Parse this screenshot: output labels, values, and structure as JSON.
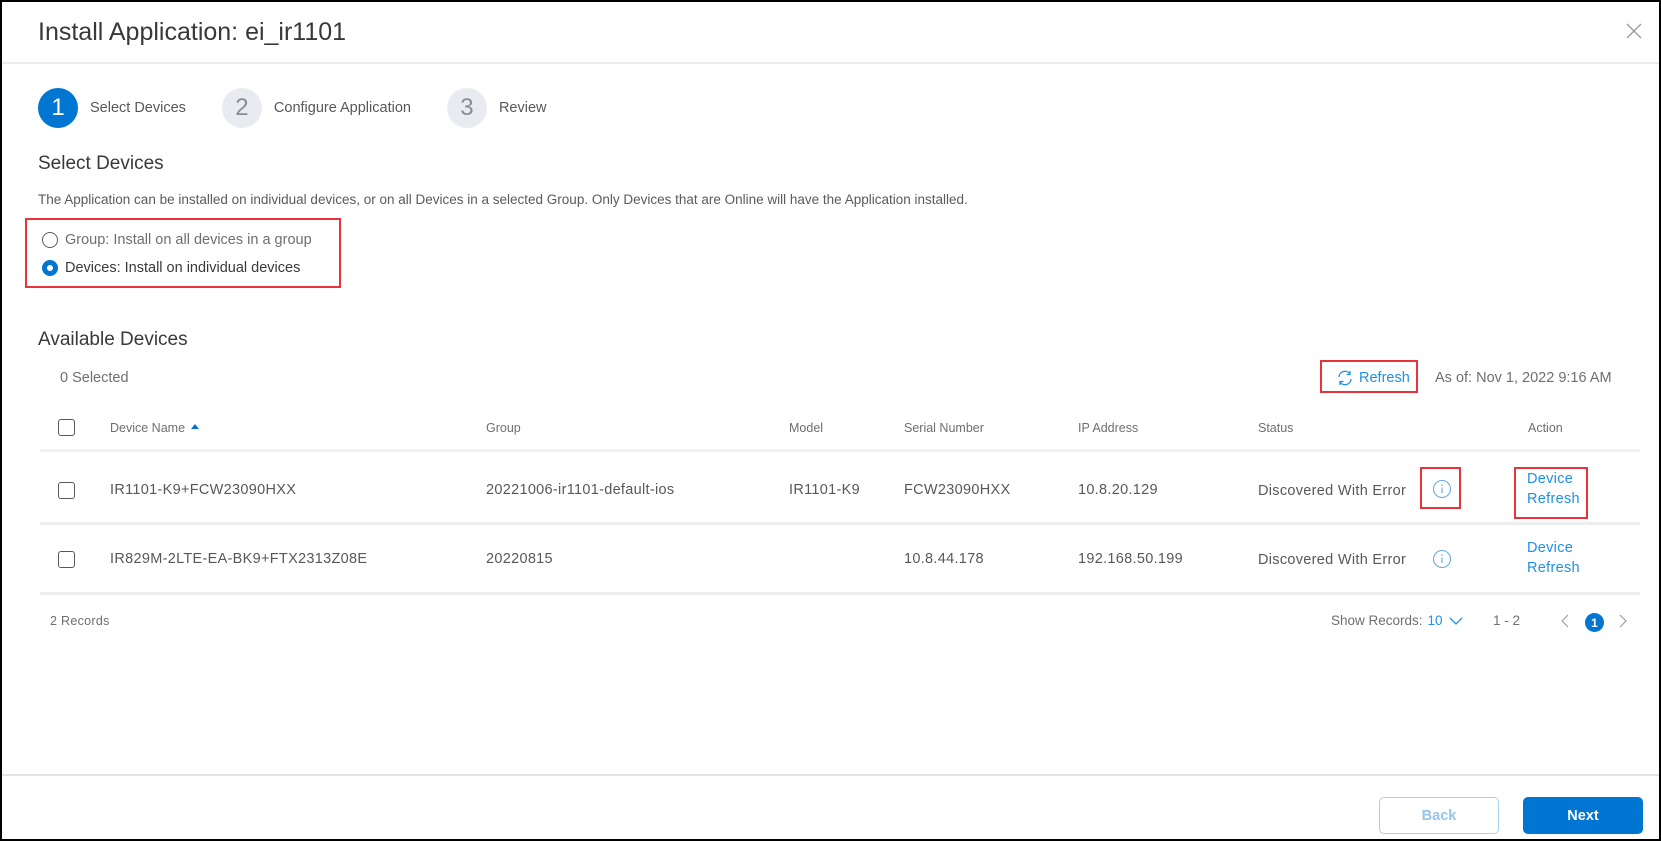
{
  "modal": {
    "title": "Install Application: ei_ir1101"
  },
  "stepper": {
    "steps": [
      {
        "number": "1",
        "label": "Select Devices",
        "state": "active"
      },
      {
        "number": "2",
        "label": "Configure Application",
        "state": "inactive"
      },
      {
        "number": "3",
        "label": "Review",
        "state": "inactive"
      }
    ]
  },
  "select_devices": {
    "title": "Select Devices",
    "description": "The Application can be installed on individual devices, or on all Devices in a selected Group. Only Devices that are Online will have the Application installed.",
    "options": [
      {
        "label": "Group: Install on all devices in a group",
        "selected": false
      },
      {
        "label": "Devices: Install on individual devices",
        "selected": true
      }
    ]
  },
  "available_devices": {
    "title": "Available Devices",
    "selected_count": "0 Selected",
    "refresh_label": "Refresh",
    "as_of": "As of: Nov 1, 2022 9:16 AM",
    "columns": [
      "Device Name",
      "Group",
      "Model",
      "Serial Number",
      "IP Address",
      "Status",
      "Action"
    ],
    "sort_column": "Device Name",
    "rows": [
      {
        "device_name": "IR1101-K9+FCW23090HXX",
        "group": "20221006-ir1101-default-ios",
        "model": "IR1101-K9",
        "serial_number": "FCW23090HXX",
        "ip_address": "10.8.20.129",
        "status": "Discovered With Error",
        "action_line1": "Device",
        "action_line2": "Refresh"
      },
      {
        "device_name": "IR829M-2LTE-EA-BK9+FTX2313Z08E",
        "group": "20220815",
        "model": "",
        "serial_number": "10.8.44.178",
        "ip_address": "192.168.50.199",
        "status": "Discovered With Error",
        "action_line1": "Device",
        "action_line2": "Refresh"
      }
    ]
  },
  "pagination": {
    "records": "2 Records",
    "show_records_label": "Show Records:",
    "show_records_value": "10",
    "range": "1 - 2",
    "current_page": "1"
  },
  "footer": {
    "back_label": "Back",
    "next_label": "Next"
  },
  "colors": {
    "primary": "#0175d2",
    "link": "#1e90e6",
    "highlight": "#e8323c"
  }
}
